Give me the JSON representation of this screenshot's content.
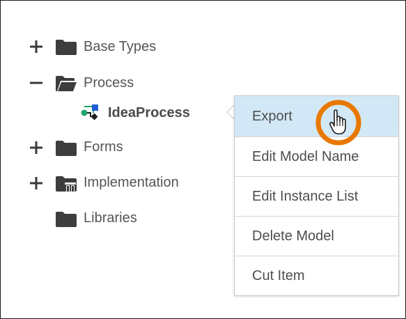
{
  "tree": {
    "items": [
      {
        "label": "Base Types",
        "expander": "plus",
        "icon": "folder-icon"
      },
      {
        "label": "Process",
        "expander": "minus",
        "icon": "open-folder-icon"
      },
      {
        "label": "IdeaProcess",
        "expander": "none",
        "icon": "process-model-icon"
      },
      {
        "label": "Forms",
        "expander": "plus",
        "icon": "folder-icon"
      },
      {
        "label": "Implementation",
        "expander": "plus",
        "icon": "folder-implementation-icon"
      },
      {
        "label": "Libraries",
        "expander": "none",
        "icon": "folder-icon"
      }
    ]
  },
  "context_menu": {
    "items": [
      {
        "label": "Export",
        "active": true
      },
      {
        "label": "Edit Model Name"
      },
      {
        "label": "Edit Instance List"
      },
      {
        "label": "Delete Model"
      },
      {
        "label": "Cut Item"
      }
    ]
  },
  "colors": {
    "folder": "#3d3d3d",
    "active_menu_bg": "#d3e8f6",
    "cursor_ring": "#e87800",
    "process_green": "#1fa76a",
    "process_blue": "#1e5fd6"
  },
  "cursor": {
    "icon": "hand-pointer-icon"
  }
}
